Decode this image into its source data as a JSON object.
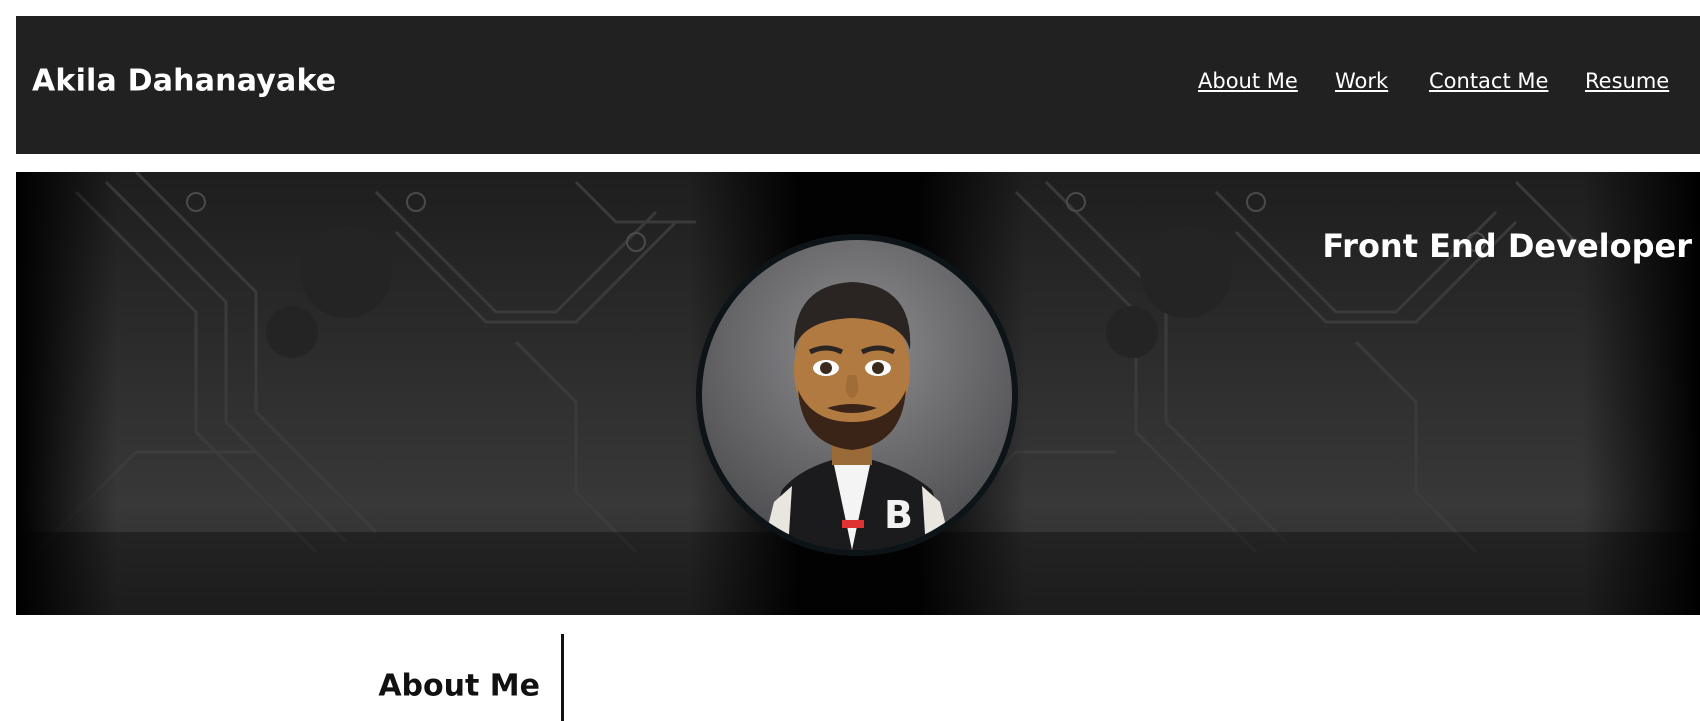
{
  "header": {
    "title": "Akila Dahanayake",
    "nav": [
      {
        "label": "About Me"
      },
      {
        "label": "Work"
      },
      {
        "label": "Contact Me"
      },
      {
        "label": "Resume"
      }
    ]
  },
  "hero": {
    "tagline": "Front End Developer",
    "background": "circuit-board-pattern",
    "avatar": "memoji-avatar"
  },
  "about": {
    "heading": "About Me"
  },
  "colors": {
    "header_bg": "#212121",
    "hero_bg": "#2c2c2c",
    "text_light": "#ffffff",
    "text_dark": "#111111"
  }
}
